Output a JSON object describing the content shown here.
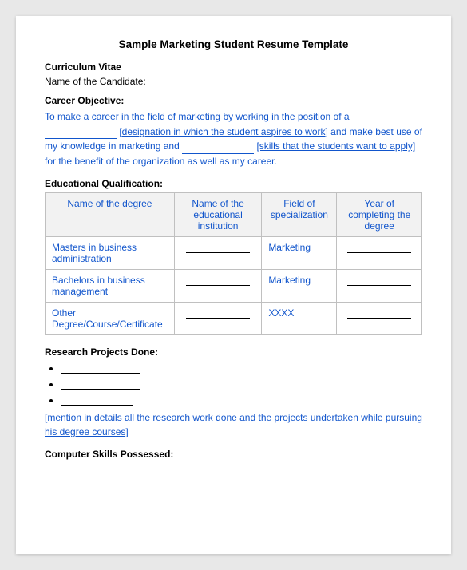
{
  "title": "Sample Marketing Student Resume Template",
  "sections": {
    "curriculum_vitae": "Curriculum Vitae",
    "candidate_label": "Name of the Candidate:",
    "career_objective": {
      "label": "Career Objective:",
      "text_parts": [
        "To make a career in the field of marketing by working in the position of a ",
        " [designation in which the student aspires to work] and make best use of my knowledge in marketing and ",
        " [skills that the students want to apply] for the benefit of the organization as well as my career."
      ]
    },
    "educational_qualification": {
      "label": "Educational Qualification:",
      "columns": [
        "Name of the degree",
        "Name of the educational institution",
        "Field of specialization",
        "Year of completing the degree"
      ],
      "rows": [
        {
          "degree": "Masters in business administration",
          "institution": "",
          "field": "Marketing",
          "year": ""
        },
        {
          "degree": "Bachelors in business management",
          "institution": "",
          "field": "Marketing",
          "year": ""
        },
        {
          "degree": "Other Degree/Course/Certificate",
          "institution": "",
          "field": "XXXX",
          "year": ""
        }
      ]
    },
    "research_projects": {
      "label": "Research Projects Done:",
      "bullets": [
        "",
        "",
        ""
      ],
      "note": "[mention in details all the research work done and the projects undertaken while pursuing his degree courses]"
    },
    "computer_skills": {
      "label": "Computer Skills Possessed:"
    }
  }
}
